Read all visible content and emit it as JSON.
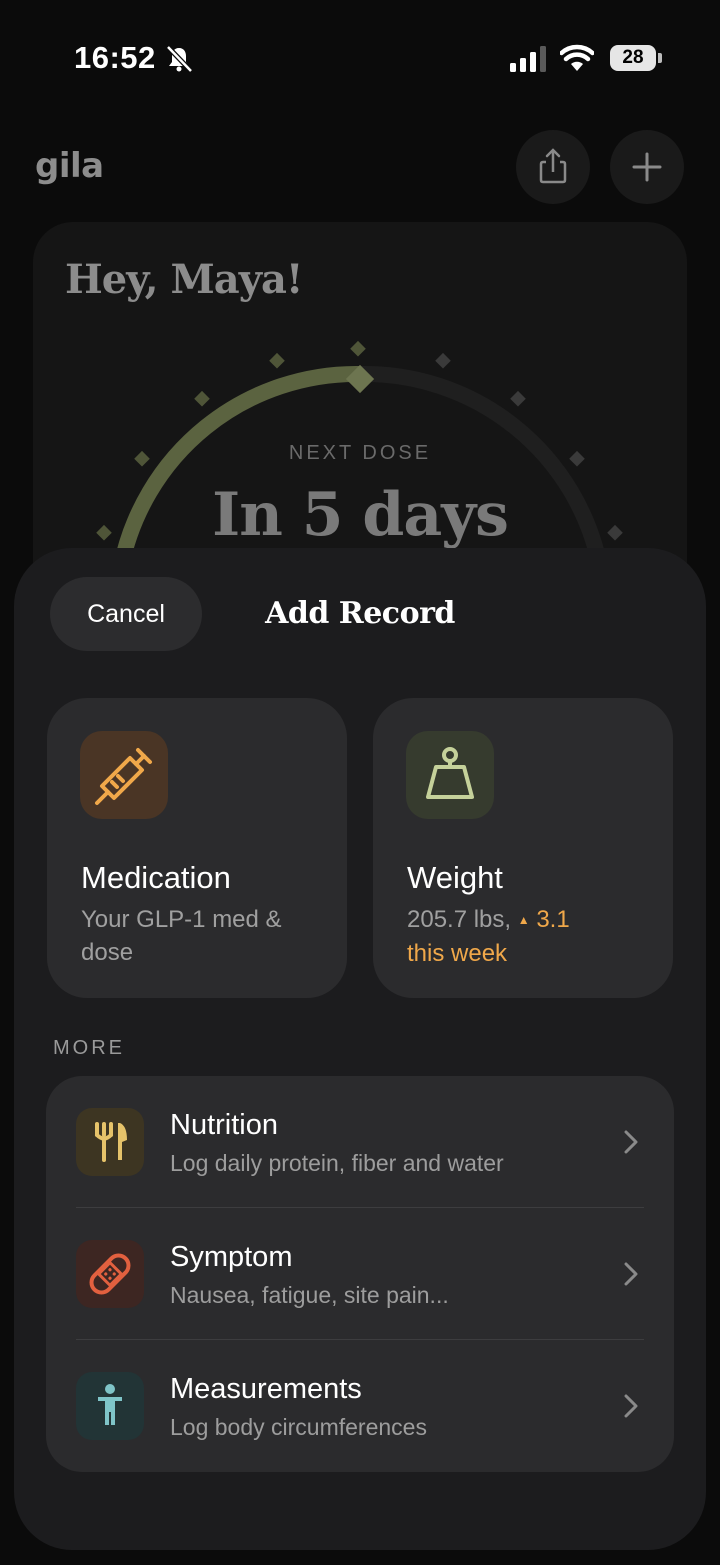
{
  "status_bar": {
    "time": "16:52",
    "battery": "28"
  },
  "home": {
    "logo": "gila",
    "greeting": "Hey, Maya!",
    "next_dose_label": "NEXT DOSE",
    "next_dose_value": "In 5 days"
  },
  "sheet": {
    "cancel_label": "Cancel",
    "title": "Add Record",
    "tiles": [
      {
        "title": "Medication",
        "subtitle": "Your GLP-1 med & dose",
        "icon": "syringe-icon"
      },
      {
        "title": "Weight",
        "subtitle": "205.7 lbs,",
        "delta": "3.1",
        "delta_suffix": "this week",
        "icon": "kettlebell-icon"
      }
    ],
    "more_label": "MORE",
    "rows": [
      {
        "title": "Nutrition",
        "subtitle": "Log daily protein, fiber and water",
        "icon": "fork-knife-icon"
      },
      {
        "title": "Symptom",
        "subtitle": "Nausea, fatigue, site pain...",
        "icon": "bandage-icon"
      },
      {
        "title": "Measurements",
        "subtitle": "Log body circumferences",
        "icon": "person-icon"
      }
    ]
  },
  "colors": {
    "background": "#0b0b0b",
    "sheet": "#1c1c1e",
    "card": "#2b2b2d",
    "accent_orange": "#f0a84a",
    "arc_green": "#5b6340",
    "nutrition_icon": "#e6c36a",
    "symptom_icon": "#e2603f",
    "measurements_icon": "#7fc4c8"
  }
}
